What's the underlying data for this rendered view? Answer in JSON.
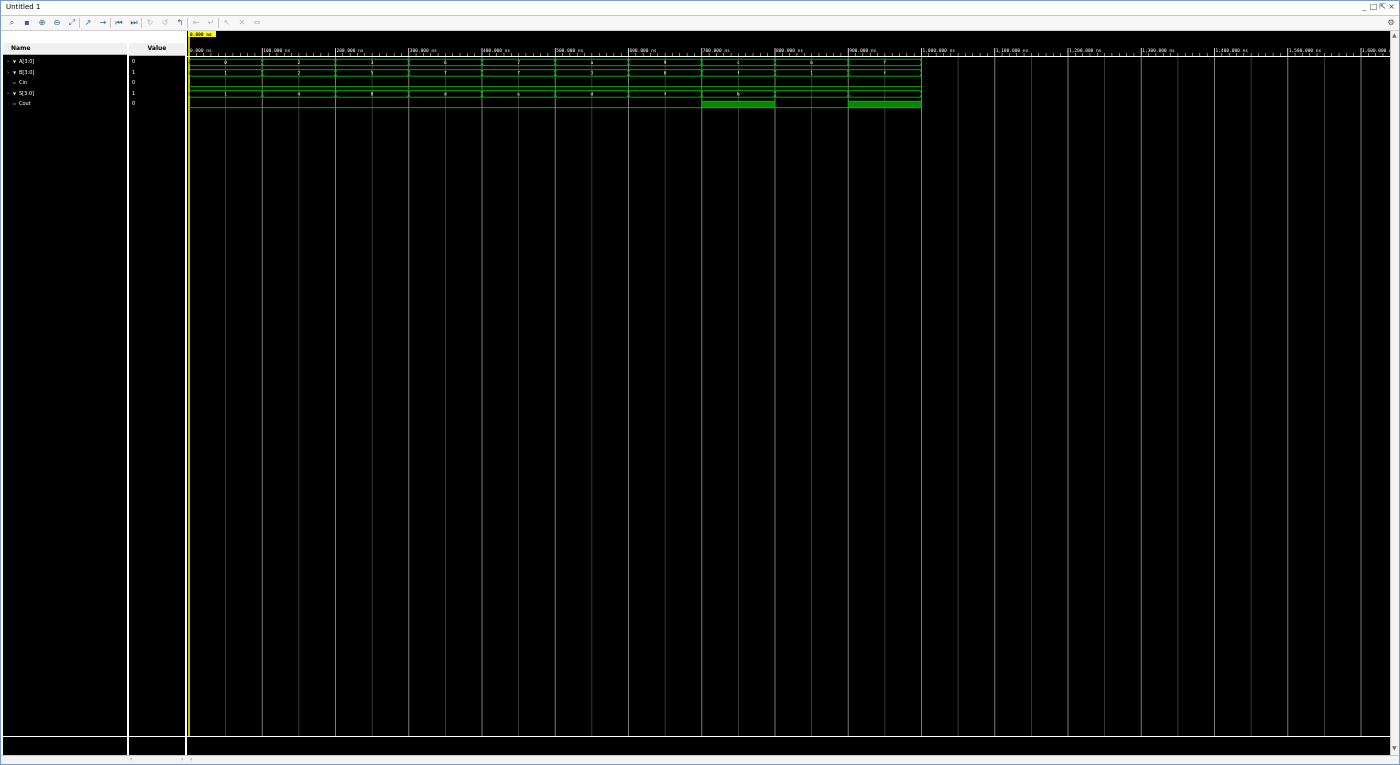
{
  "window": {
    "title": "Untitled 1",
    "controls": [
      "_",
      "□",
      "⇱",
      "×"
    ]
  },
  "toolbar": {
    "icons": [
      "search-icon",
      "save-icon",
      "zoom-in-icon",
      "zoom-out-icon",
      "zoom-fit-icon",
      "cursor-to-zero-icon",
      "cursor-to-end-icon",
      "go-to-start-icon",
      "go-to-end-icon",
      "prev-transition-icon",
      "next-transition-icon",
      "add-marker-icon",
      "prev-marker-icon",
      "next-marker-icon",
      "swap-cursors-icon",
      "snap-icon",
      "flip-icon",
      "settings-icon"
    ]
  },
  "columns": {
    "name": "Name",
    "value": "Value"
  },
  "signals": [
    {
      "name": "A[3:0]",
      "value": "0",
      "kind": "bus"
    },
    {
      "name": "B[3:0]",
      "value": "1",
      "kind": "bus"
    },
    {
      "name": "Cin",
      "value": "0",
      "kind": "bit"
    },
    {
      "name": "S[3:0]",
      "value": "1",
      "kind": "bus"
    },
    {
      "name": "Cout",
      "value": "0",
      "kind": "bit"
    }
  ],
  "cursor": {
    "time": 0,
    "label": "0.000 ns"
  },
  "timeline": {
    "unit": "ns",
    "ticks": [
      {
        "t": 0,
        "label": "0.000 ns"
      },
      {
        "t": 100,
        "label": "100.000 ns"
      },
      {
        "t": 200,
        "label": "200.000 ns"
      },
      {
        "t": 300,
        "label": "300.000 ns"
      },
      {
        "t": 400,
        "label": "400.000 ns"
      },
      {
        "t": 500,
        "label": "500.000 ns"
      },
      {
        "t": 600,
        "label": "600.000 ns"
      },
      {
        "t": 700,
        "label": "700.000 ns"
      },
      {
        "t": 800,
        "label": "800.000 ns"
      },
      {
        "t": 900,
        "label": "900.000 ns"
      },
      {
        "t": 1000,
        "label": "1,000.000 ns"
      },
      {
        "t": 1100,
        "label": "1,100.000 ns"
      },
      {
        "t": 1200,
        "label": "1,200.000 ns"
      },
      {
        "t": 1300,
        "label": "1,300.000 ns"
      },
      {
        "t": 1400,
        "label": "1,400.000 ns"
      },
      {
        "t": 1500,
        "label": "1,500.000 ns"
      },
      {
        "t": 1600,
        "label": "1,600.000 ns"
      }
    ],
    "sim_end": 1000,
    "segment_width": 100
  },
  "waveforms": {
    "A": [
      "0",
      "2",
      "3",
      "6",
      "7",
      "a",
      "9",
      "c",
      "b",
      "f"
    ],
    "B": [
      "1",
      "2",
      "5",
      "7",
      "7",
      "3",
      "6",
      "f",
      "1",
      "f"
    ],
    "Cin": [
      0,
      0,
      0,
      0,
      0,
      0,
      0,
      0,
      0,
      0
    ],
    "S": [
      "1",
      "4",
      "8",
      "d",
      "e",
      "d",
      "f",
      "b",
      "",
      ""
    ],
    "Cout": [
      0,
      0,
      0,
      0,
      0,
      0,
      0,
      1,
      0,
      1
    ]
  },
  "colors": {
    "waveform": "#00c000",
    "waveform_fill": "#008a00",
    "cursor": "#ffff00",
    "grid": "#7a7a7a",
    "background": "#000000"
  }
}
